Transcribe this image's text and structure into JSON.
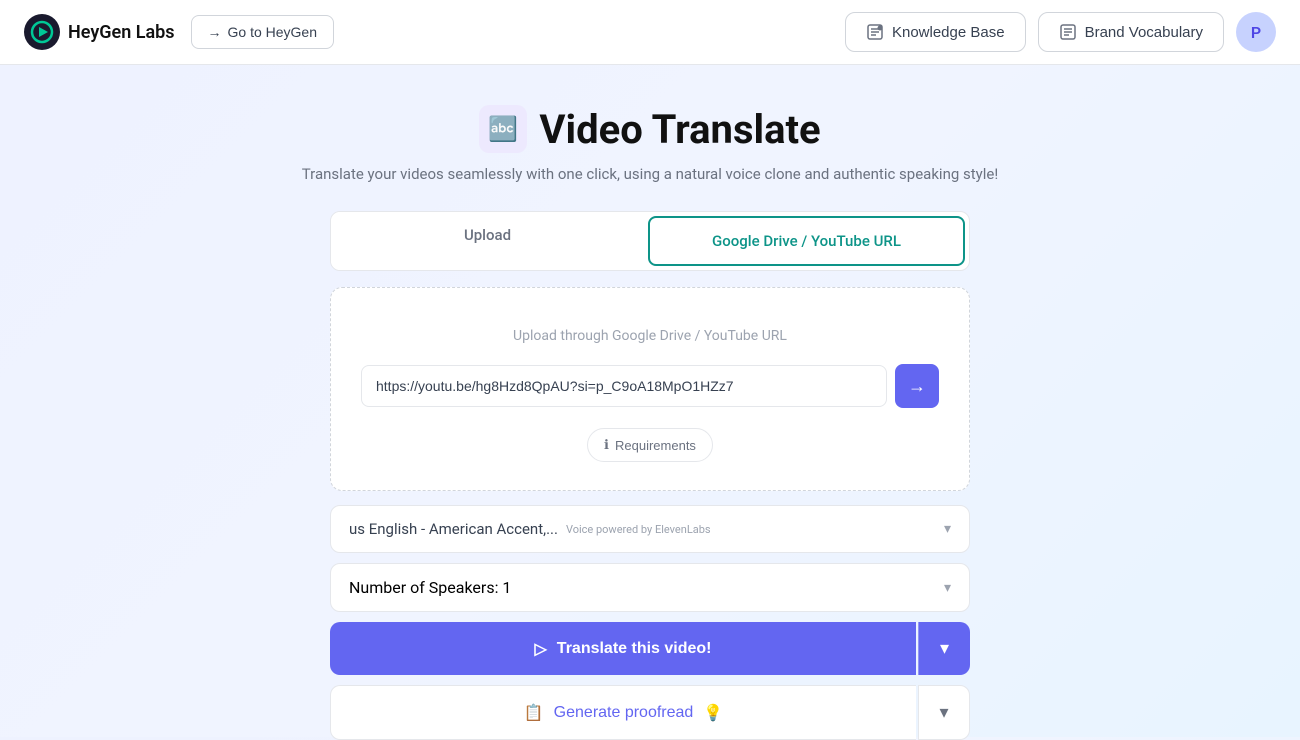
{
  "header": {
    "logo_text": "HeyGen Labs",
    "go_to_heygen_label": "Go to HeyGen",
    "knowledge_base_label": "Knowledge Base",
    "brand_vocabulary_label": "Brand Vocabulary",
    "avatar_letter": "P"
  },
  "page": {
    "title": "Video Translate",
    "subtitle": "Translate your videos seamlessly with one click, using a natural voice clone and authentic speaking style!",
    "title_icon": "🔤"
  },
  "tabs": [
    {
      "label": "Upload",
      "active": false
    },
    {
      "label": "Google Drive / YouTube URL",
      "active": true
    }
  ],
  "upload_area": {
    "label": "Upload through Google Drive / YouTube URL",
    "url_placeholder": "https://youtu.be/hg8Hzd8QpAU?si=p_C9oA18MpO1HZz7",
    "url_value": "https://youtu.be/hg8Hzd8QpAU?si=p_C9oA18MpO1HZz7",
    "requirements_label": "Requirements"
  },
  "voice_select": {
    "value": "us English - American Accent,...",
    "powered_by": "Voice powered by ElevenLabs"
  },
  "speakers_select": {
    "label": "Number of Speakers: 1"
  },
  "translate_btn": {
    "label": "Translate this video!"
  },
  "proofread_btn": {
    "label": "Generate proofread"
  },
  "icons": {
    "arrow_right": "→",
    "chevron_down": "∨",
    "arrow_submit": "→",
    "info": "ℹ",
    "translate_icon": "▷",
    "proofread_icon": "📋",
    "lightbulb": "💡"
  }
}
